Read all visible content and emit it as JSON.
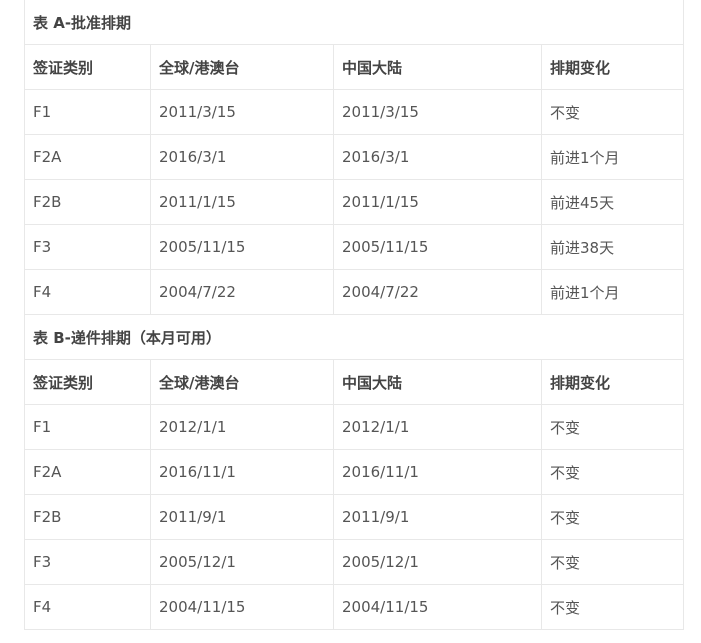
{
  "table_a": {
    "title": "表 A-批准排期",
    "headers": [
      "签证类别",
      "全球/港澳台",
      "中国大陆",
      "排期变化"
    ],
    "rows": [
      [
        "F1",
        "2011/3/15",
        "2011/3/15",
        "不变"
      ],
      [
        "F2A",
        "2016/3/1",
        "2016/3/1",
        "前进1个月"
      ],
      [
        "F2B",
        "2011/1/15",
        "2011/1/15",
        "前进45天"
      ],
      [
        "F3",
        "2005/11/15",
        "2005/11/15",
        "前进38天"
      ],
      [
        "F4",
        "2004/7/22",
        "2004/7/22",
        "前进1个月"
      ]
    ]
  },
  "table_b": {
    "title": "表 B-递件排期（本月可用）",
    "headers": [
      "签证类别",
      "全球/港澳台",
      "中国大陆",
      "排期变化"
    ],
    "rows": [
      [
        "F1",
        "2012/1/1",
        "2012/1/1",
        "不变"
      ],
      [
        "F2A",
        "2016/11/1",
        "2016/11/1",
        "不变"
      ],
      [
        "F2B",
        "2011/9/1",
        "2011/9/1",
        "不变"
      ],
      [
        "F3",
        "2005/12/1",
        "2005/12/1",
        "不变"
      ],
      [
        "F4",
        "2004/11/15",
        "2004/11/15",
        "不变"
      ]
    ]
  },
  "colors": {
    "border": "#e8e8e8",
    "text": "#555555",
    "heading_text": "#444444"
  }
}
